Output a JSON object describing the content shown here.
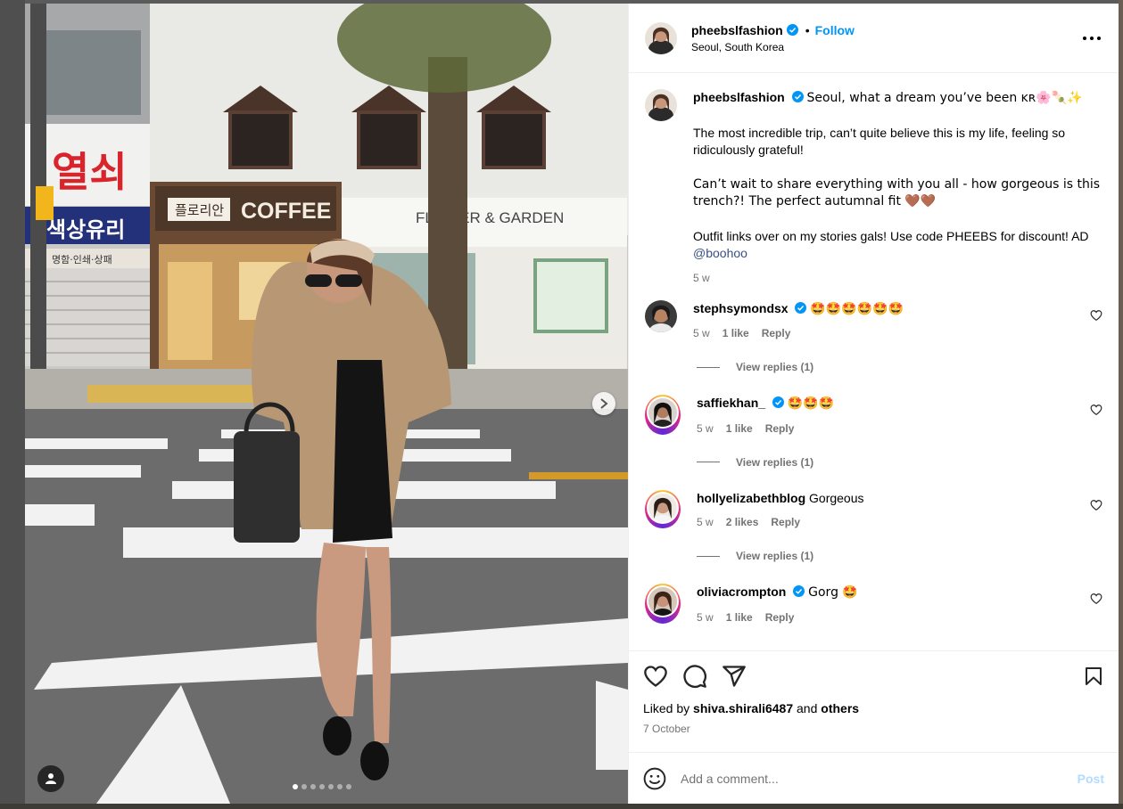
{
  "post": {
    "author": "pheebslfashion",
    "follow_label": "Follow",
    "separator": "•",
    "location": "Seoul, South Korea"
  },
  "photo": {
    "scene_signs": {
      "coffee": "COFFEE",
      "korean_cafe": "플로리안",
      "garden": "FLOWER & GARDEN",
      "red_sign": "열쇠",
      "glass_sign": "색상유리",
      "print_sign": "명함·인쇄·상패"
    },
    "carousel_count": 7,
    "carousel_active": 1
  },
  "caption": {
    "username": "pheebslfashion",
    "first_line": "Seoul, what a dream you’ve been ᴋʀ🌸🍡✨",
    "paragraph_2": "The most incredible trip, can’t quite believe this is my life, feeling so ridiculously grateful!",
    "paragraph_3": "Can’t wait to share everything with you all - how gorgeous is this trench?! The perfect autumnal fit 🤎🤎",
    "paragraph_4_prefix": "Outfit links over on my stories gals! Use code PHEEBS for discount! AD ",
    "mention": "@boohoo",
    "age": "5 w"
  },
  "comments": [
    {
      "username": "stephsymondsx",
      "verified": true,
      "text": "🤩🤩🤩🤩🤩🤩",
      "age": "5 w",
      "likes": "1 like",
      "reply": "Reply",
      "view_replies": "View replies (1)"
    },
    {
      "username": "saffiekhan_",
      "verified": true,
      "text": "🤩🤩🤩",
      "age": "5 w",
      "likes": "1 like",
      "reply": "Reply",
      "view_replies": "View replies (1)"
    },
    {
      "username": "hollyelizabethblog",
      "verified": false,
      "text": "Gorgeous",
      "age": "5 w",
      "likes": "2 likes",
      "reply": "Reply",
      "view_replies": "View replies (1)"
    },
    {
      "username": "oliviacrompton",
      "verified": true,
      "text": "Gorg 🤩",
      "age": "5 w",
      "likes": "1 like",
      "reply": "Reply"
    }
  ],
  "actions": {
    "icons": [
      "heart-icon",
      "comment-icon",
      "share-icon",
      "bookmark-icon"
    ],
    "liked_by_prefix": "Liked by ",
    "liked_by_user": "shiva.shirali6487",
    "liked_by_and": " and ",
    "liked_by_others": "others",
    "date": "7 October"
  },
  "add_comment": {
    "placeholder": "Add a comment...",
    "post_label": "Post"
  },
  "colors": {
    "accent": "#0095f6",
    "verified": "#0095f6",
    "muted": "#737373",
    "post_disabled": "#b3dbff"
  }
}
